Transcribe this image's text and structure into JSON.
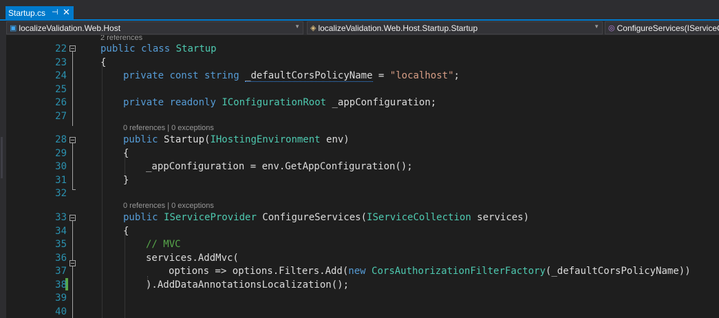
{
  "tab": {
    "title": "Startup.cs",
    "pin_icon": "pin-icon",
    "close_icon": "close-icon"
  },
  "navigation": {
    "project": "localizeValidation.Web.Host",
    "type": "localizeValidation.Web.Host.Startup.Startup",
    "member": "ConfigureServices(IServiceC"
  },
  "code_lens": {
    "class_refs": "2 references",
    "ctor_refs": "0 references | 0 exceptions",
    "method_refs": "0 references | 0 exceptions"
  },
  "line_numbers": [
    "22",
    "23",
    "24",
    "25",
    "26",
    "27",
    "28",
    "29",
    "30",
    "31",
    "32",
    "33",
    "34",
    "35",
    "36",
    "37",
    "38",
    "39",
    "40"
  ],
  "code": {
    "l22": {
      "kw1": "public",
      "kw2": "class",
      "type": "Startup"
    },
    "l23": "{",
    "l24": {
      "kw1": "private",
      "kw2": "const",
      "kw3": "string",
      "name": "_defaultCorsPolicyName",
      "eq": " = ",
      "str": "\"localhost\"",
      "end": ";"
    },
    "l26": {
      "kw1": "private",
      "kw2": "readonly",
      "type": "IConfigurationRoot",
      "rest": " _appConfiguration;"
    },
    "l28": {
      "kw": "public",
      "name": " Startup(",
      "type": "IHostingEnvironment",
      "rest": " env)"
    },
    "l29": "{",
    "l30": "_appConfiguration = env.GetAppConfiguration();",
    "l31": "}",
    "l33": {
      "kw": "public",
      "type1": "IServiceProvider",
      "name": " ConfigureServices(",
      "type2": "IServiceCollection",
      "rest": " services)"
    },
    "l34": "{",
    "l35": "// MVC",
    "l36": "services.AddMvc(",
    "l37": {
      "pre": "options => options.Filters.Add(",
      "kw": "new",
      "type": "CorsAuthorizationFilterFactory",
      "rest": "(_defaultCorsPolicyName))"
    },
    "l38": ").AddDataAnnotationsLocalization();"
  }
}
